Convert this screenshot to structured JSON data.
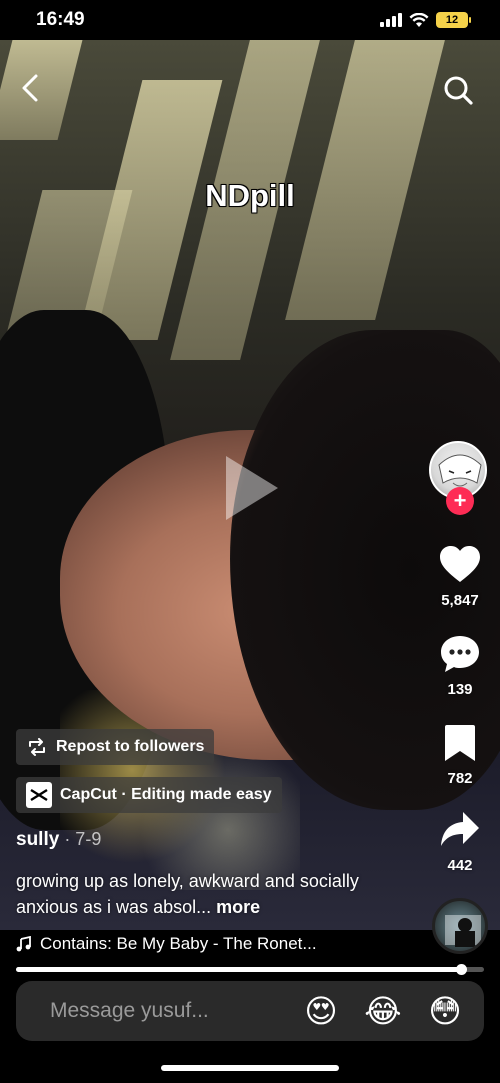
{
  "status_bar": {
    "time": "16:49",
    "battery": "12"
  },
  "video": {
    "overlay_text": "NDpill"
  },
  "rail": {
    "likes": "5,847",
    "comments": "139",
    "saves": "782",
    "shares": "442"
  },
  "repost": {
    "label": "Repost to followers"
  },
  "capcut": {
    "label": "CapCut · Editing made easy"
  },
  "post": {
    "author": "sully",
    "date": " · 7-9",
    "caption": "growing up as lonely, awkward and socially anxious as i was absol...",
    "more": " more"
  },
  "music": {
    "label": "Contains: Be My Baby - The Ronet..."
  },
  "progress": {
    "fraction": 0.95
  },
  "message": {
    "placeholder": "Message yusuf..."
  },
  "emojis": [
    "😍",
    "😂",
    "😳"
  ],
  "colors": {
    "accent": "#fe2c55",
    "battery": "#f5d24a"
  }
}
